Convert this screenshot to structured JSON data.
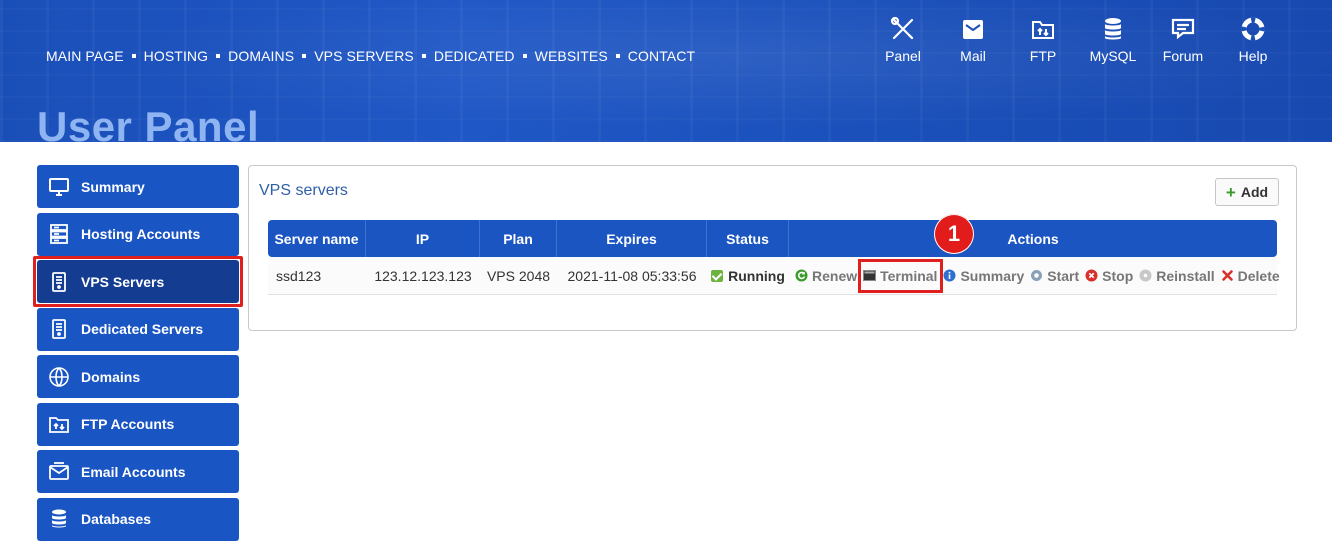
{
  "topnav": {
    "items": [
      "MAIN PAGE",
      "HOSTING",
      "DOMAINS",
      "VPS SERVERS",
      "DEDICATED",
      "WEBSITES",
      "CONTACT"
    ]
  },
  "tools": [
    {
      "label": "Panel",
      "icon": "tools-icon"
    },
    {
      "label": "Mail",
      "icon": "mail-icon"
    },
    {
      "label": "FTP",
      "icon": "ftp-folder-icon"
    },
    {
      "label": "MySQL",
      "icon": "database-icon"
    },
    {
      "label": "Forum",
      "icon": "forum-icon"
    },
    {
      "label": "Help",
      "icon": "lifebuoy-icon"
    }
  ],
  "page_title": "User Panel",
  "sidebar": {
    "items": [
      {
        "label": "Summary",
        "icon": "monitor-icon"
      },
      {
        "label": "Hosting Accounts",
        "icon": "server-icon"
      },
      {
        "label": "VPS Servers",
        "icon": "vps-server-icon",
        "active": true
      },
      {
        "label": "Dedicated Servers",
        "icon": "dedicated-server-icon"
      },
      {
        "label": "Domains",
        "icon": "www-globe-icon"
      },
      {
        "label": "FTP Accounts",
        "icon": "ftp-folder-icon"
      },
      {
        "label": "Email Accounts",
        "icon": "email-icon"
      },
      {
        "label": "Databases",
        "icon": "database-icon"
      }
    ]
  },
  "panel": {
    "title": "VPS servers",
    "add_label": "Add",
    "columns": [
      "Server name",
      "IP",
      "Plan",
      "Expires",
      "Status",
      "Actions"
    ],
    "rows": [
      {
        "server_name": "ssd123",
        "ip": "123.12.123.123",
        "plan": "VPS 2048",
        "expires": "2021-11-08 05:33:56",
        "status": "Running",
        "actions": [
          "Renew",
          "Terminal",
          "Summary",
          "Start",
          "Stop",
          "Reinstall",
          "Delete"
        ]
      }
    ]
  },
  "annotation": {
    "badge": "1"
  },
  "colors": {
    "brand_blue": "#1a55c4",
    "active_blue": "#143c91",
    "highlight_red": "#e0201f",
    "title_blue": "#8fb4f2"
  }
}
